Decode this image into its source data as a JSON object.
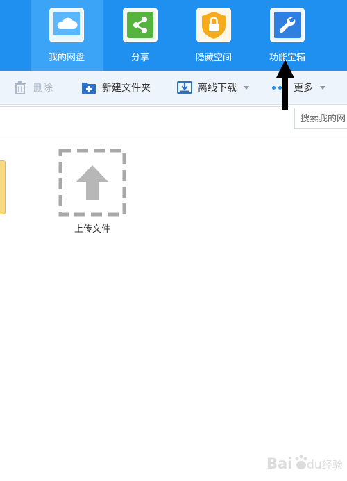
{
  "nav": {
    "items": [
      {
        "label": "我的网盘",
        "icon": "cloud-drive-icon"
      },
      {
        "label": "分享",
        "icon": "share-icon"
      },
      {
        "label": "隐藏空间",
        "icon": "lock-icon"
      },
      {
        "label": "功能宝箱",
        "icon": "wrench-toolbox-icon"
      }
    ],
    "active_index": 0
  },
  "toolbar": {
    "delete_label": "删除",
    "new_folder_label": "新建文件夹",
    "offline_download_label": "离线下载",
    "more_label": "更多"
  },
  "search": {
    "placeholder": "搜索我的网"
  },
  "content": {
    "upload_label": "上传文件"
  },
  "colors": {
    "topbar": "#1f8ff0",
    "active_nav": "#3ca4f7",
    "share_green": "#56b33f",
    "lock_orange": "#f6ab1a"
  },
  "watermark": {
    "text": "Bai du 经验"
  }
}
